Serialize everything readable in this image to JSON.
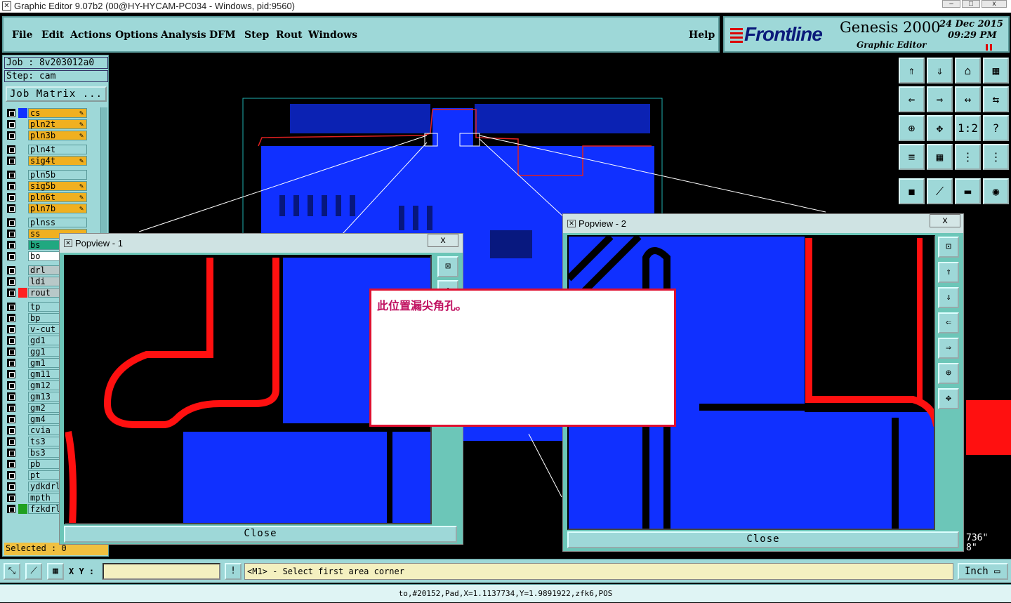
{
  "window": {
    "title": "Graphic Editor 9.07b2 (00@HY-HYCAM-PC034 - Windows, pid:9560)",
    "minimize": "–",
    "maximize": "□",
    "close": "x"
  },
  "menu": {
    "items": [
      "File",
      "Edit",
      "Actions",
      "Options",
      "Analysis",
      "DFM",
      "Step",
      "Rout",
      "Windows"
    ],
    "help": "Help"
  },
  "brand": {
    "logo": "Frontline",
    "product": "Genesis 2000",
    "subtitle": "Graphic Editor",
    "date": "24 Dec 2015",
    "time": "09:29 PM"
  },
  "job": {
    "job_label": "Job : 8v203012a0",
    "step_label": "Step: cam",
    "matrix_button": "Job Matrix ..."
  },
  "layers": [
    {
      "name": "cs",
      "bg": "#f0b020",
      "swatch": "#1030ff",
      "editable": true
    },
    {
      "name": "pln2t",
      "bg": "#f0b020",
      "swatch": "#9ed8d8",
      "editable": true
    },
    {
      "name": "pln3b",
      "bg": "#f0b020",
      "swatch": "#9ed8d8",
      "editable": true
    },
    {
      "name": "pln4t",
      "bg": "#9ed8d8",
      "swatch": "#9ed8d8",
      "editable": false
    },
    {
      "name": "sig4t",
      "bg": "#f0b020",
      "swatch": "#9ed8d8",
      "editable": true
    },
    {
      "name": "pln5b",
      "bg": "#9ed8d8",
      "swatch": "#9ed8d8",
      "editable": false
    },
    {
      "name": "sig5b",
      "bg": "#f0b020",
      "swatch": "#9ed8d8",
      "editable": true
    },
    {
      "name": "pln6t",
      "bg": "#f0b020",
      "swatch": "#9ed8d8",
      "editable": true
    },
    {
      "name": "pln7b",
      "bg": "#f0b020",
      "swatch": "#9ed8d8",
      "editable": true
    },
    {
      "name": "plnss",
      "bg": "#9ed8d8",
      "swatch": "#9ed8d8",
      "editable": false
    },
    {
      "name": "ss",
      "bg": "#f0b020",
      "swatch": "#9ed8d8",
      "editable": false
    },
    {
      "name": "bs",
      "bg": "#20a880",
      "swatch": "#9ed8d8",
      "editable": false
    },
    {
      "name": "bo",
      "bg": "#ffffff",
      "swatch": "#9ed8d8",
      "editable": false
    },
    {
      "name": "drl",
      "bg": "#b8c8c8",
      "swatch": "#9ed8d8",
      "editable": false
    },
    {
      "name": "ldi",
      "bg": "#b8c8c8",
      "swatch": "#9ed8d8",
      "editable": false
    },
    {
      "name": "rout",
      "bg": "#b8c8c8",
      "swatch": "#ff2020",
      "editable": false
    },
    {
      "name": "tp",
      "bg": "#9ed8d8",
      "swatch": "#9ed8d8",
      "editable": false
    },
    {
      "name": "bp",
      "bg": "#9ed8d8",
      "swatch": "#9ed8d8",
      "editable": false
    },
    {
      "name": "v-cut",
      "bg": "#9ed8d8",
      "swatch": "#9ed8d8",
      "editable": false
    },
    {
      "name": "gd1",
      "bg": "#9ed8d8",
      "swatch": "#9ed8d8",
      "editable": false
    },
    {
      "name": "gg1",
      "bg": "#9ed8d8",
      "swatch": "#9ed8d8",
      "editable": false
    },
    {
      "name": "gm1",
      "bg": "#9ed8d8",
      "swatch": "#9ed8d8",
      "editable": false
    },
    {
      "name": "gm11",
      "bg": "#9ed8d8",
      "swatch": "#9ed8d8",
      "editable": false
    },
    {
      "name": "gm12",
      "bg": "#9ed8d8",
      "swatch": "#9ed8d8",
      "editable": false
    },
    {
      "name": "gm13",
      "bg": "#9ed8d8",
      "swatch": "#9ed8d8",
      "editable": false
    },
    {
      "name": "gm2",
      "bg": "#9ed8d8",
      "swatch": "#9ed8d8",
      "editable": false
    },
    {
      "name": "gm4",
      "bg": "#9ed8d8",
      "swatch": "#9ed8d8",
      "editable": false
    },
    {
      "name": "cvia",
      "bg": "#9ed8d8",
      "swatch": "#9ed8d8",
      "editable": false
    },
    {
      "name": "ts3",
      "bg": "#9ed8d8",
      "swatch": "#9ed8d8",
      "editable": false
    },
    {
      "name": "bs3",
      "bg": "#9ed8d8",
      "swatch": "#9ed8d8",
      "editable": false
    },
    {
      "name": "pb",
      "bg": "#9ed8d8",
      "swatch": "#9ed8d8",
      "editable": false
    },
    {
      "name": "pt",
      "bg": "#9ed8d8",
      "swatch": "#9ed8d8",
      "editable": false
    },
    {
      "name": "ydkdrl",
      "bg": "#9ed8d8",
      "swatch": "#9ed8d8",
      "editable": false
    },
    {
      "name": "mpth",
      "bg": "#9ed8d8",
      "swatch": "#9ed8d8",
      "editable": false
    },
    {
      "name": "fzkdrl",
      "bg": "#9ed8d8",
      "swatch": "#20a020",
      "editable": false
    }
  ],
  "selected_label": "Selected : 0",
  "popview1": {
    "title": "Popview - 1",
    "close_x": "x",
    "close_label": "Close"
  },
  "popview2": {
    "title": "Popview - 2",
    "close_x": "x",
    "close_label": "Close"
  },
  "annotation": {
    "text": "此位置漏尖角孔。"
  },
  "bottom": {
    "xy_label": "X Y :",
    "xy_value": "",
    "prompt": "<M1> - Select first area corner",
    "unit": "Inch",
    "warn": "!"
  },
  "coords_readout": {
    "line1": "736\"",
    "line2": "8\""
  },
  "status": "to,#20152,Pad,X=1.1137734,Y=1.9891922,zfk6,POS",
  "tool_glyphs": [
    "⇑",
    "⇓",
    "⌂",
    "▦",
    "⇐",
    "⇒",
    "↔",
    "⇆",
    "⊕",
    "✥",
    "1:2",
    "?",
    "≡",
    "▦",
    "⋮",
    "⋮",
    "◼",
    "⟋",
    "▬",
    "◉"
  ]
}
